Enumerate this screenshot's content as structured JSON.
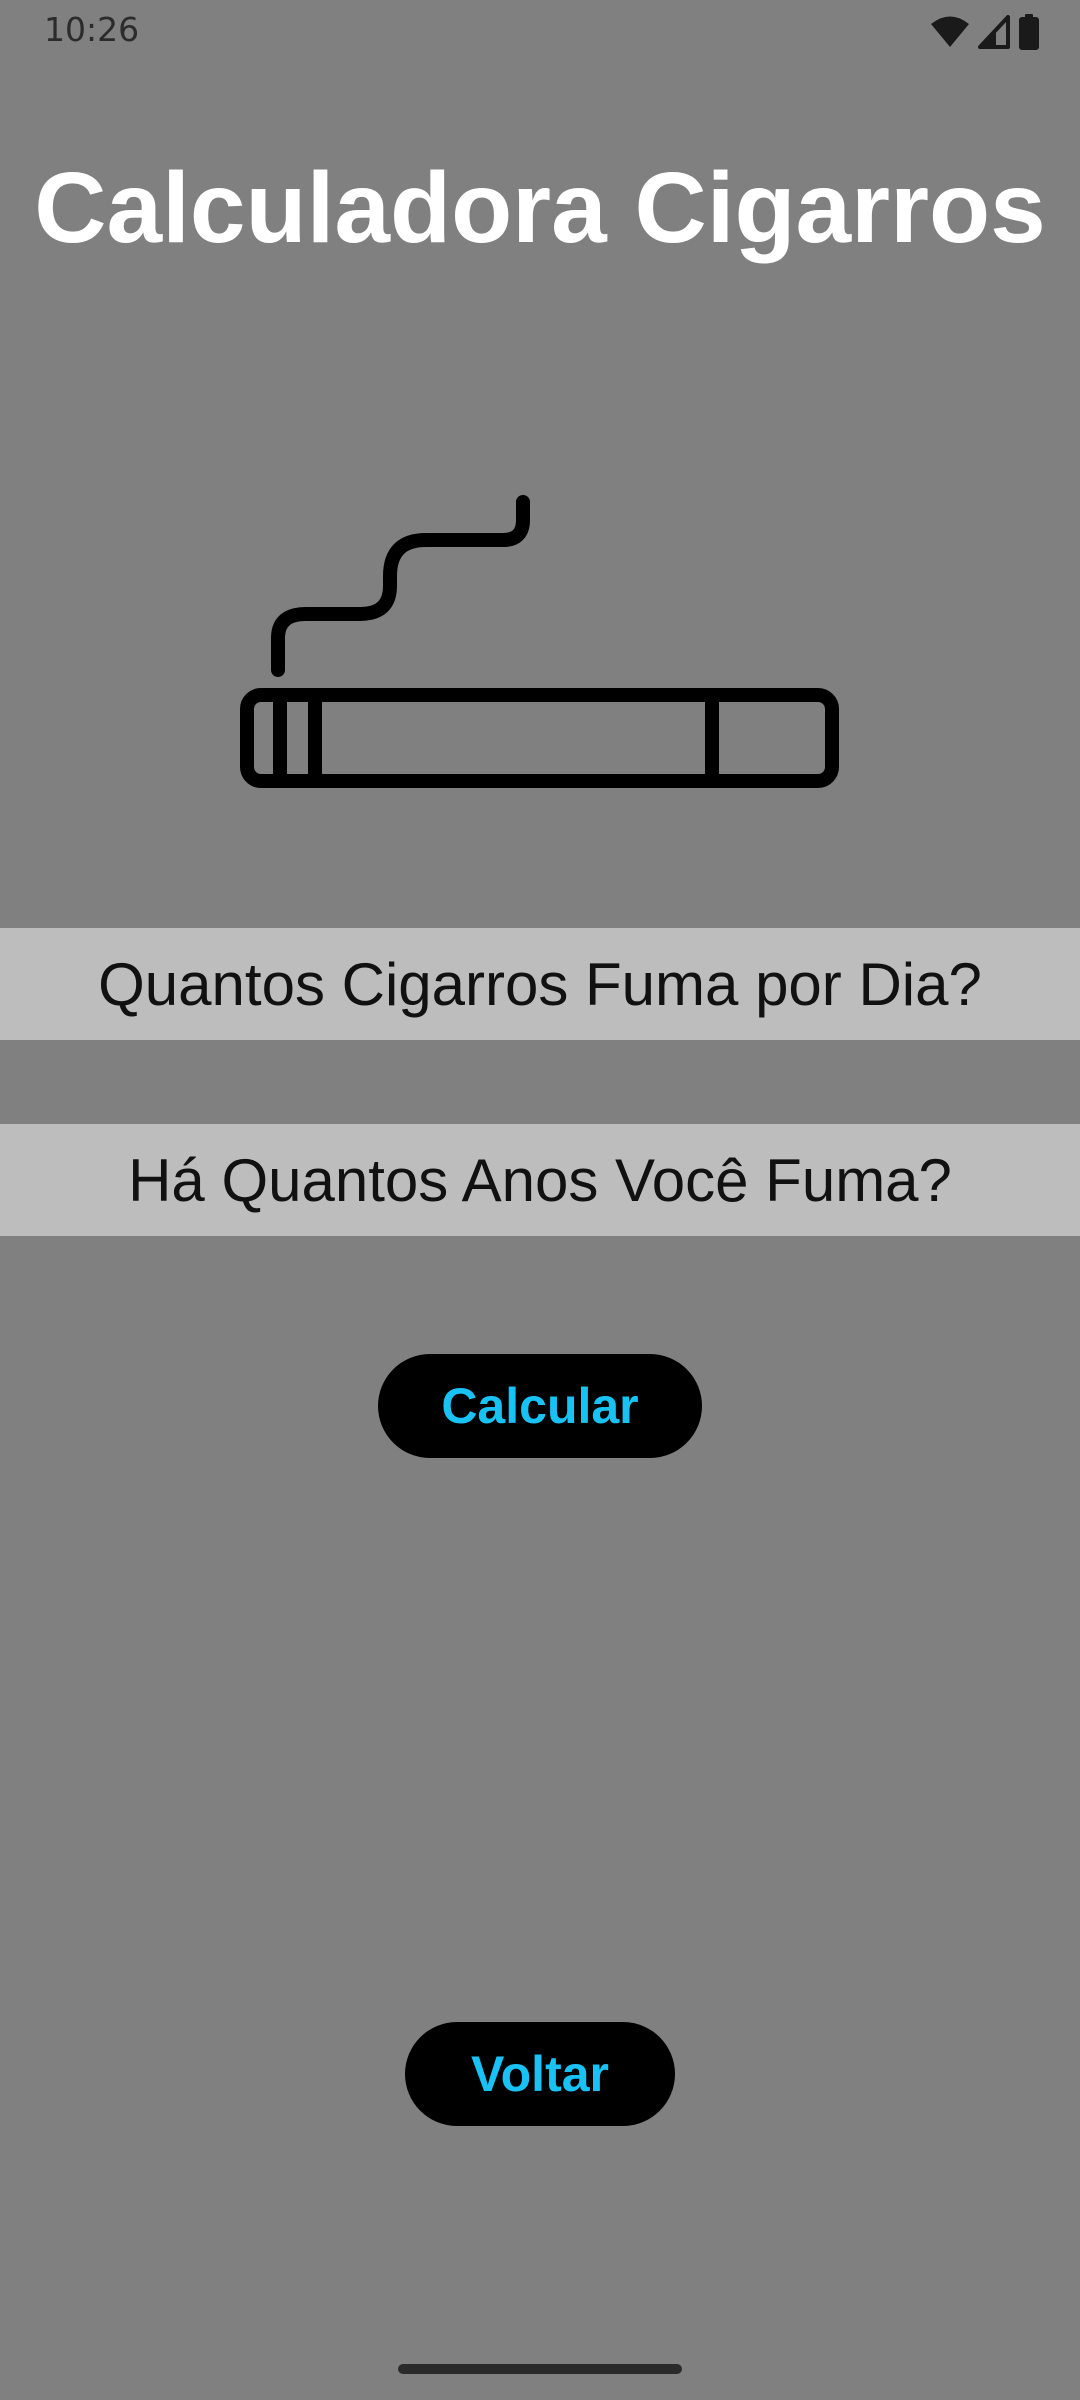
{
  "status_bar": {
    "time": "10:26",
    "icons": [
      "wifi-icon",
      "signal-icon",
      "battery-icon"
    ]
  },
  "header": {
    "title": "Calculadora Cigarros"
  },
  "illustration": {
    "icon": "cigarette-icon"
  },
  "form": {
    "cigarettes_per_day": {
      "placeholder": "Quantos Cigarros Fuma por Dia?",
      "value": ""
    },
    "years_smoking": {
      "placeholder": "Há Quantos Anos Você Fuma?",
      "value": ""
    },
    "calculate_label": "Calcular"
  },
  "footer": {
    "back_label": "Voltar"
  },
  "colors": {
    "background": "#808080",
    "input_background": "#bdbdbd",
    "button_background": "#000000",
    "button_text": "#19c2f5",
    "title_text": "#ffffff"
  }
}
